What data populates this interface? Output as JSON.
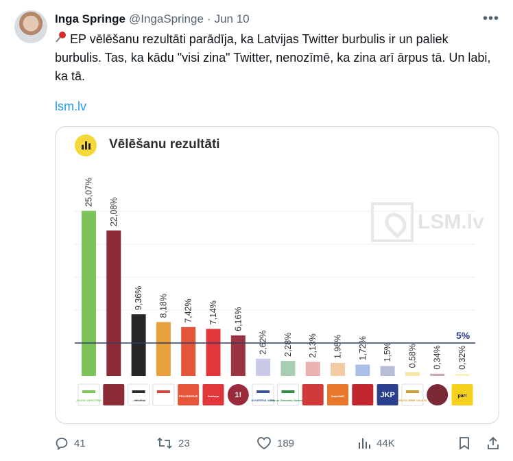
{
  "tweet": {
    "author_name": "Inga Springe",
    "handle": "@IngaSpringe",
    "separator": "·",
    "date": "Jun 10",
    "more_icon": "more-horizontal-icon",
    "pin_icon": "pushpin-icon",
    "text": "EP vēlēšanu rezultāti parādīja, ka Latvijas Twitter burbulis ir un paliek burbulis. Tas, ka kādu \"visi zina\" Twitter, nenozīmē, ka zina arī ārpus tā. Un labi, ka tā.",
    "link_text": "lsm.lv"
  },
  "card": {
    "title": "Vēlēšanu rezultāti",
    "watermark": "LSM.lv"
  },
  "chart_data": {
    "type": "bar",
    "values": [
      25.07,
      22.08,
      9.36,
      8.18,
      7.42,
      7.14,
      6.16,
      2.62,
      2.28,
      2.13,
      1.98,
      1.72,
      1.5,
      0.58,
      0.34,
      0.32
    ],
    "data_labels": [
      "25,07%",
      "22,08%",
      "9,36%",
      "8,18%",
      "7,42%",
      "7,14%",
      "6,16%",
      "2,62%",
      "2,28%",
      "2,13%",
      "1,98%",
      "1,72%",
      "1,5%",
      "0,58%",
      "0,34%",
      "0,32%"
    ],
    "colors": [
      "#7cc45a",
      "#8b2c37",
      "#262626",
      "#e8a13c",
      "#e4553a",
      "#e3363a",
      "#9a3443",
      "#c7c9e6",
      "#a8cdb3",
      "#e9b1b2",
      "#f3cba4",
      "#a9bfe5",
      "#b9bed6",
      "#f6e5a9",
      "#c9a9b9",
      "#f8f1b9"
    ],
    "logo_labels": [
      "JAUNĀ VIENOTĪBA",
      "",
      "...attīstībai",
      "",
      "PROGRESĪVIE",
      "Saskaņa",
      "1!",
      "SUVERĒNĀ VARA",
      "Zaļo un Zemnieku Savienība",
      "",
      "StabiliātE!",
      "",
      "JKP",
      "TAUTA ZEME VALSTS",
      "",
      "par!"
    ],
    "logo_colors": [
      "#7cc45a",
      "#8b2c37",
      "#2b2b2b",
      "#d4473a",
      "#e4553a",
      "#e3363a",
      "#9a2a3c",
      "#3a56a0",
      "#2f8a43",
      "#d23a3a",
      "#e8772a",
      "#c2262e",
      "#2b3f8c",
      "#c99a2e",
      "#7a2a35",
      "#f7d21c"
    ],
    "threshold": {
      "value": 5,
      "label": "5%"
    },
    "ylim": [
      0,
      30
    ],
    "grid": true
  },
  "actions": {
    "reply_icon": "reply-icon",
    "reply_count": "41",
    "retweet_icon": "retweet-icon",
    "retweet_count": "23",
    "like_icon": "heart-icon",
    "like_count": "189",
    "views_icon": "views-icon",
    "views_count": "44K",
    "bookmark_icon": "bookmark-icon",
    "share_icon": "share-icon"
  }
}
